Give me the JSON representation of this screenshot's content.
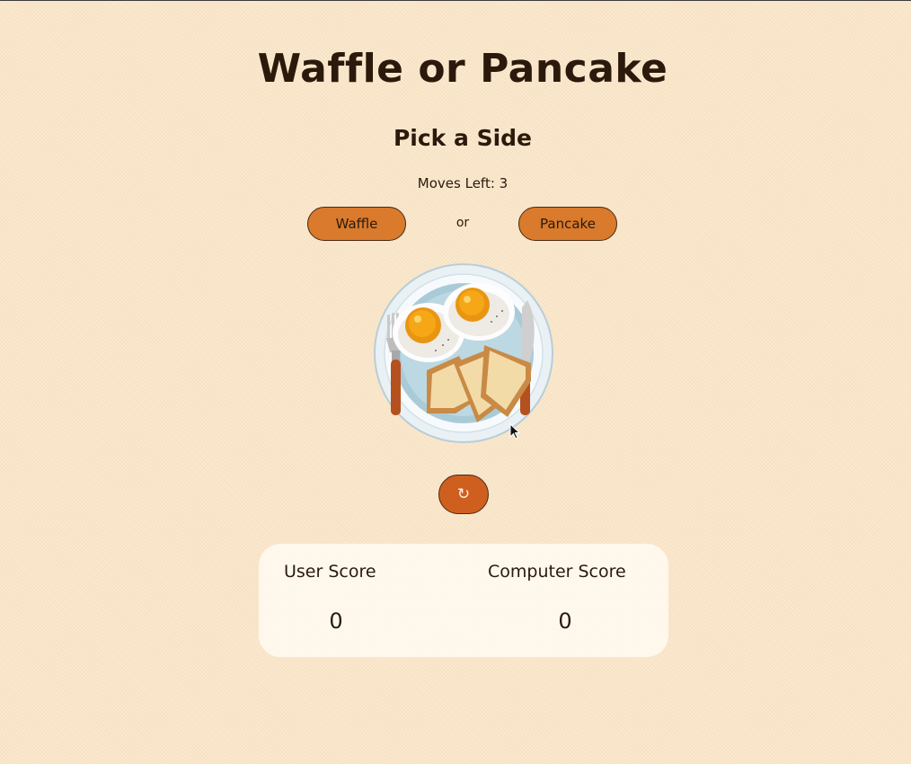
{
  "header": {
    "title": "Waffle or Pancake",
    "subtitle": "Pick a Side"
  },
  "game": {
    "moves_label": "Moves Left: 3",
    "choices": {
      "waffle_label": "Waffle",
      "or_label": "or",
      "pancake_label": "Pancake"
    },
    "image": {
      "icon": "breakfast-plate-illustration"
    },
    "reset": {
      "icon": "refresh-icon",
      "glyph": "↻"
    }
  },
  "scores": {
    "user_label": "User Score",
    "user_value": "0",
    "computer_label": "Computer Score",
    "computer_value": "0"
  },
  "colors": {
    "background": "#fbe9cf",
    "button": "#d97a2c",
    "reset_button": "#cf5f1e",
    "text": "#2b1a0c",
    "panel": "#fffaf2"
  }
}
